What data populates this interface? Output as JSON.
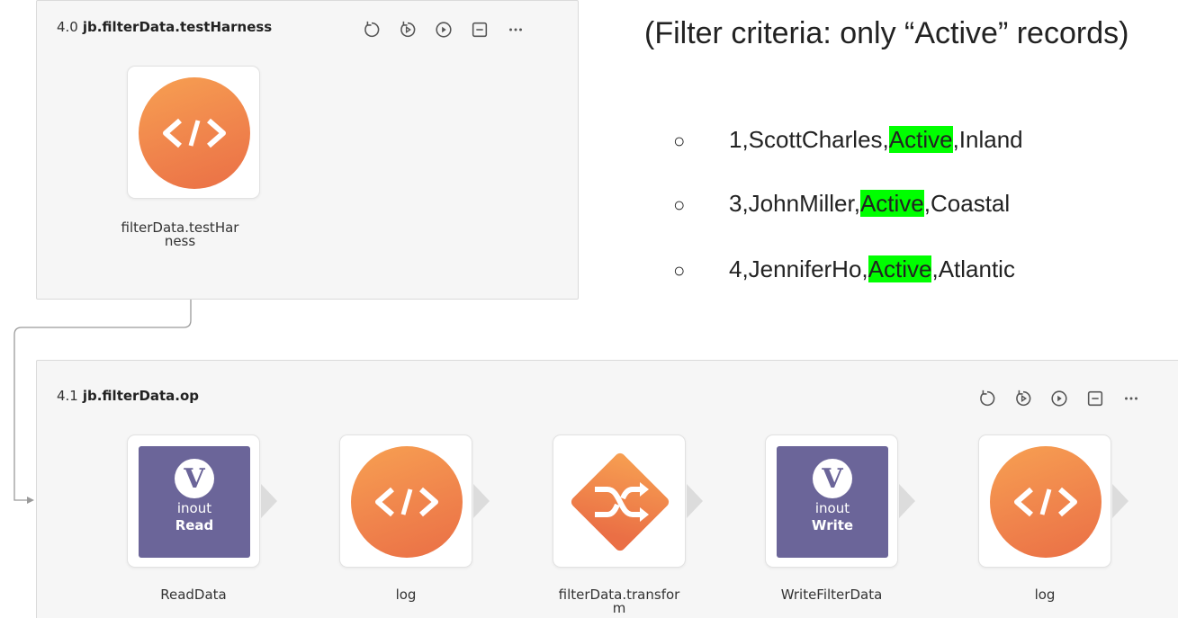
{
  "pipeline_top": {
    "number": "4.0",
    "name": "jb.filterData.testHarness",
    "snaps": [
      {
        "label": "filterData.testHarness",
        "icon": "code-icon"
      }
    ]
  },
  "pipeline_bottom": {
    "number": "4.1",
    "name": "jb.filterData.op",
    "snaps": [
      {
        "label": "ReadData",
        "icon": "variable-read-icon",
        "badge_top": "inout",
        "badge_bottom": "Read"
      },
      {
        "label": "log",
        "icon": "code-icon"
      },
      {
        "label": "filterData.transform",
        "icon": "shuffle-icon"
      },
      {
        "label": "WriteFilterData",
        "icon": "variable-write-icon",
        "badge_top": "inout",
        "badge_bottom": "Write"
      },
      {
        "label": "log",
        "icon": "code-icon"
      }
    ]
  },
  "toolbar_icons": [
    "retry-icon",
    "retry-from-icon",
    "play-icon",
    "collapse-icon",
    "more-icon"
  ],
  "variable_glyph": "V",
  "notes": {
    "criteria": "(Filter criteria: only “Active” records)",
    "bullet_glyph": "○",
    "records": [
      {
        "pre": "1,ScottCharles,",
        "status": "Active",
        "post": ",Inland"
      },
      {
        "pre": "3,JohnMiller,",
        "status": "Active",
        "post": ",Coastal"
      },
      {
        "pre": "4,JenniferHo,",
        "status": "Active",
        "post": ",Atlantic"
      }
    ]
  },
  "colors": {
    "highlight": "#00ff00",
    "snap_orange": "#f0844c",
    "snap_purple": "#6b6599",
    "panel_bg": "#f6f6f6"
  }
}
